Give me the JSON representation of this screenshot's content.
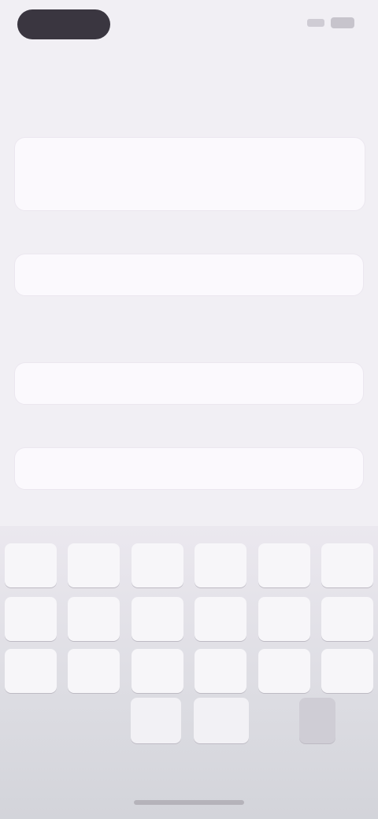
{
  "status_bar": {
    "time": ""
  },
  "nav": {
    "title": ""
  },
  "section1": {
    "label": "",
    "row1": {
      "label": "",
      "value": ""
    },
    "row2": {
      "label": "",
      "value": ""
    }
  },
  "section2": {
    "label": "",
    "placeholder": ""
  },
  "section3": {
    "label": "",
    "placeholder": ""
  },
  "section4": {
    "label": "",
    "placeholder": ""
  },
  "section5": {
    "label": ""
  },
  "keyboard": {
    "rows": [
      [
        "",
        "",
        "",
        "",
        "",
        ""
      ],
      [
        "",
        "",
        "",
        "",
        "",
        ""
      ],
      [
        "",
        "",
        "",
        "",
        "",
        ""
      ]
    ],
    "bottom": {
      "left": "",
      "middle1": "",
      "middle2": "",
      "right": ""
    }
  }
}
